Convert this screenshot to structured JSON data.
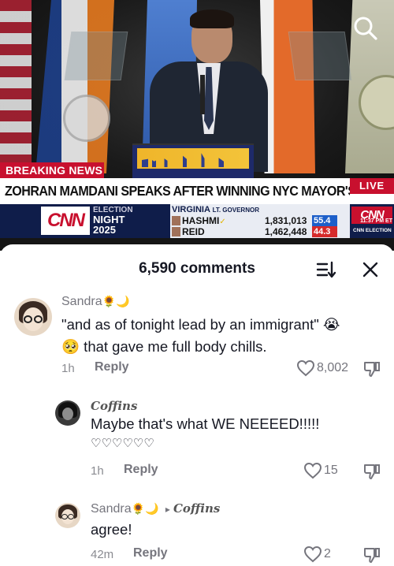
{
  "video": {
    "breaking_label": "BREAKING NEWS",
    "headline": "ZOHRAN MAMDANI SPEAKS AFTER WINNING NYC MAYOR'S RACE",
    "live_label": "LIVE",
    "network_logo": "CNN",
    "election_line1": "ELECTION",
    "election_line2": "NIGHT",
    "election_line3": "2025",
    "race": {
      "state": "VIRGINIA",
      "office": "LT. GOVERNOR",
      "candidates": [
        {
          "name": "HASHMI",
          "checkmark": "✓",
          "votes": "1,831,013",
          "pct": "55.4",
          "color": "#1d5fc9"
        },
        {
          "name": "REID",
          "checkmark": "",
          "votes": "1,462,448",
          "pct": "44.3",
          "color": "#d52a2a"
        }
      ]
    },
    "time": "11:37 PM ET",
    "footer_label": "CNN ELECTION"
  },
  "comments_header": {
    "count_label": "6,590 comments"
  },
  "comments": [
    {
      "username": "Sandra",
      "username_deco": "🌻🌙",
      "text_line1": "\"and as of tonight lead by an immigrant\" 😭",
      "text_line2": "🥺 that gave me full body chills.",
      "time": "1h",
      "reply_label": "Reply",
      "likes": "8,002"
    },
    {
      "username": "Coffins",
      "text_line1": "Maybe that's what WE NEEEED!!!!!",
      "text_line2": "♡♡♡♡♡♡",
      "time": "1h",
      "reply_label": "Reply",
      "likes": "15"
    },
    {
      "username": "Sandra",
      "username_deco": "🌻🌙",
      "reply_to_arrow": "▸",
      "reply_to": "Coffins",
      "text_line1": "agree!",
      "time": "42m",
      "reply_label": "Reply",
      "likes": "2"
    }
  ],
  "colors": {
    "cnn_red": "#c8102e",
    "ticker_navy": "#0f1d4a",
    "text_primary": "#161823",
    "text_secondary": "#75757d"
  },
  "icons": [
    "search-icon",
    "sort-icon",
    "close-icon",
    "heart-icon",
    "dislike-icon"
  ]
}
